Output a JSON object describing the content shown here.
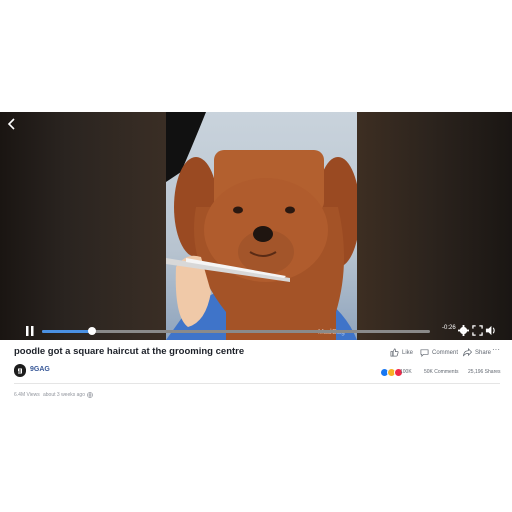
{
  "player": {
    "time_remaining": "-0:26",
    "progress": 0.13,
    "watermark": "MadGag",
    "icons": [
      "back-icon",
      "pause-icon",
      "settings-icon",
      "fullscreen-icon",
      "volume-icon"
    ]
  },
  "post": {
    "title": "poodle got a square haircut at the grooming centre",
    "page_name": "9GAG",
    "actions": {
      "like": "Like",
      "comment": "Comment",
      "share": "Share"
    },
    "stats": {
      "reactions": "100K",
      "comments": "50K Comments",
      "shares": "25,196 Shares"
    },
    "views": "6.4M Views",
    "posted": "about 3 weeks ago"
  },
  "colors": {
    "accent": "#4a90e2",
    "link": "#385898",
    "like": "#1877f2",
    "love": "#f02849",
    "haha": "#f7b125"
  }
}
